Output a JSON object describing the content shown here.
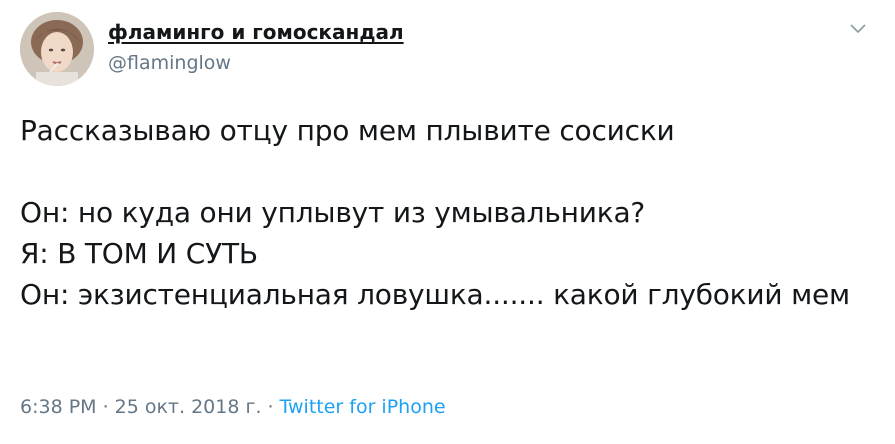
{
  "tweet": {
    "author": {
      "display_name": "фламинго и гомоскандал",
      "handle": "@flaminglow",
      "avatar_icon": "avatar-photo"
    },
    "menu_icon": "chevron-down-icon",
    "text_lines": [
      "Рассказываю отцу про мем плывите сосиски",
      "",
      "Он: но куда они уплывут из умывальника?",
      "Я: В ТОМ И СУТЬ",
      "Он: экзистенциальная ловушка....... какой глубокий мем"
    ],
    "time": "6:38 PM",
    "date": "25 окт. 2018 г.",
    "source": "Twitter for iPhone",
    "separator": "·"
  },
  "colors": {
    "text": "#14171a",
    "secondary": "#657786",
    "link": "#1da1f2",
    "background": "#ffffff"
  }
}
